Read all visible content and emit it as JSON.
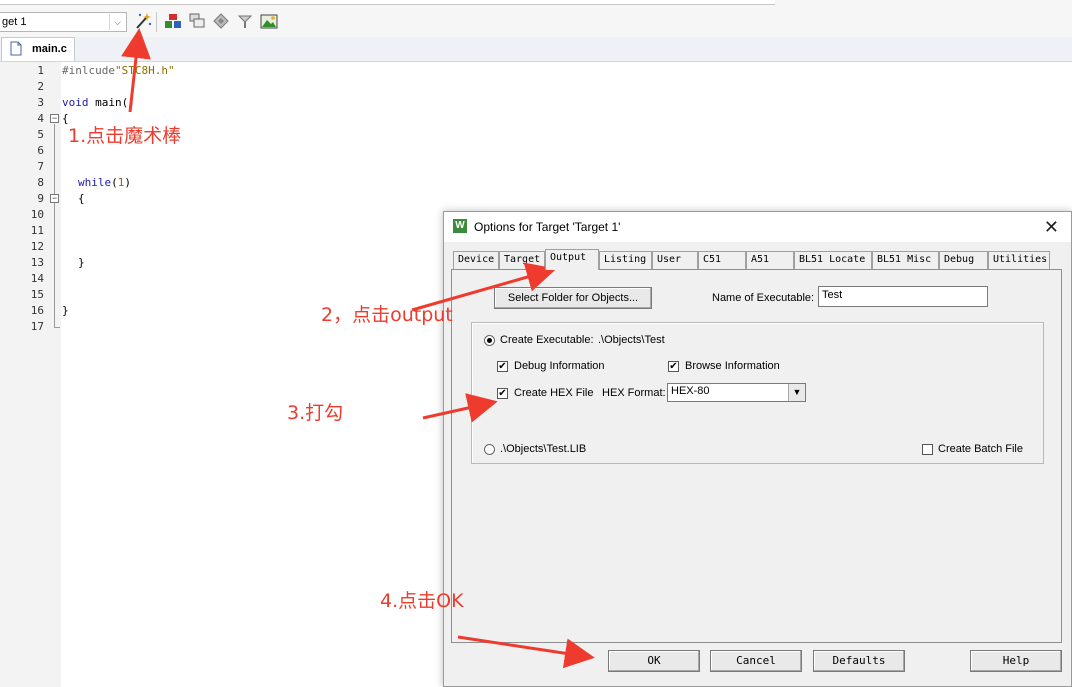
{
  "toolbar": {
    "target_value": "get 1",
    "icons": [
      "magic-wand-icon",
      "load-icon",
      "copy-icon",
      "diamond-icon",
      "download-icon",
      "image-icon"
    ]
  },
  "editor": {
    "file_tab": "main.c",
    "line_numbers": [
      "1",
      "2",
      "3",
      "4",
      "5",
      "6",
      "7",
      "8",
      "9",
      "10",
      "11",
      "12",
      "13",
      "14",
      "15",
      "16",
      "17"
    ],
    "code": {
      "l1_directive": "#inlcude",
      "l1_string": "\"STC8H.h\"",
      "l3_kw": "void",
      "l3_rest": " main()",
      "l4": "{",
      "l8_kw": "while",
      "l8_paren_open": "(",
      "l8_num": "1",
      "l8_paren_close": ")",
      "l9": "{",
      "l13": "}",
      "l16": "}"
    }
  },
  "annotations": {
    "step1": "1.点击魔术棒",
    "step2": "2，点击output",
    "step3": "3.打勾",
    "step4": "4.点击OK",
    "arrow_color": "#ee3b2d"
  },
  "dialog": {
    "title": "Options for Target 'Target 1'",
    "tabs": [
      "Device",
      "Target",
      "Output",
      "Listing",
      "User",
      "C51",
      "A51",
      "BL51 Locate",
      "BL51 Misc",
      "Debug",
      "Utilities"
    ],
    "active_tab": "Output",
    "select_folder_button": "Select Folder for Objects...",
    "name_of_executable_label": "Name of Executable:",
    "name_of_executable_value": "Test",
    "create_executable_label": "Create Executable:",
    "create_executable_path": ".\\Objects\\Test",
    "debug_information": "Debug Information",
    "browse_information": "Browse Information",
    "create_hex_file": "Create HEX File",
    "hex_format_label": "HEX Format:",
    "hex_format_value": "HEX-80",
    "create_library_path": ".\\Objects\\Test.LIB",
    "create_batch_file": "Create Batch File",
    "buttons": {
      "ok": "OK",
      "cancel": "Cancel",
      "defaults": "Defaults",
      "help": "Help"
    }
  }
}
